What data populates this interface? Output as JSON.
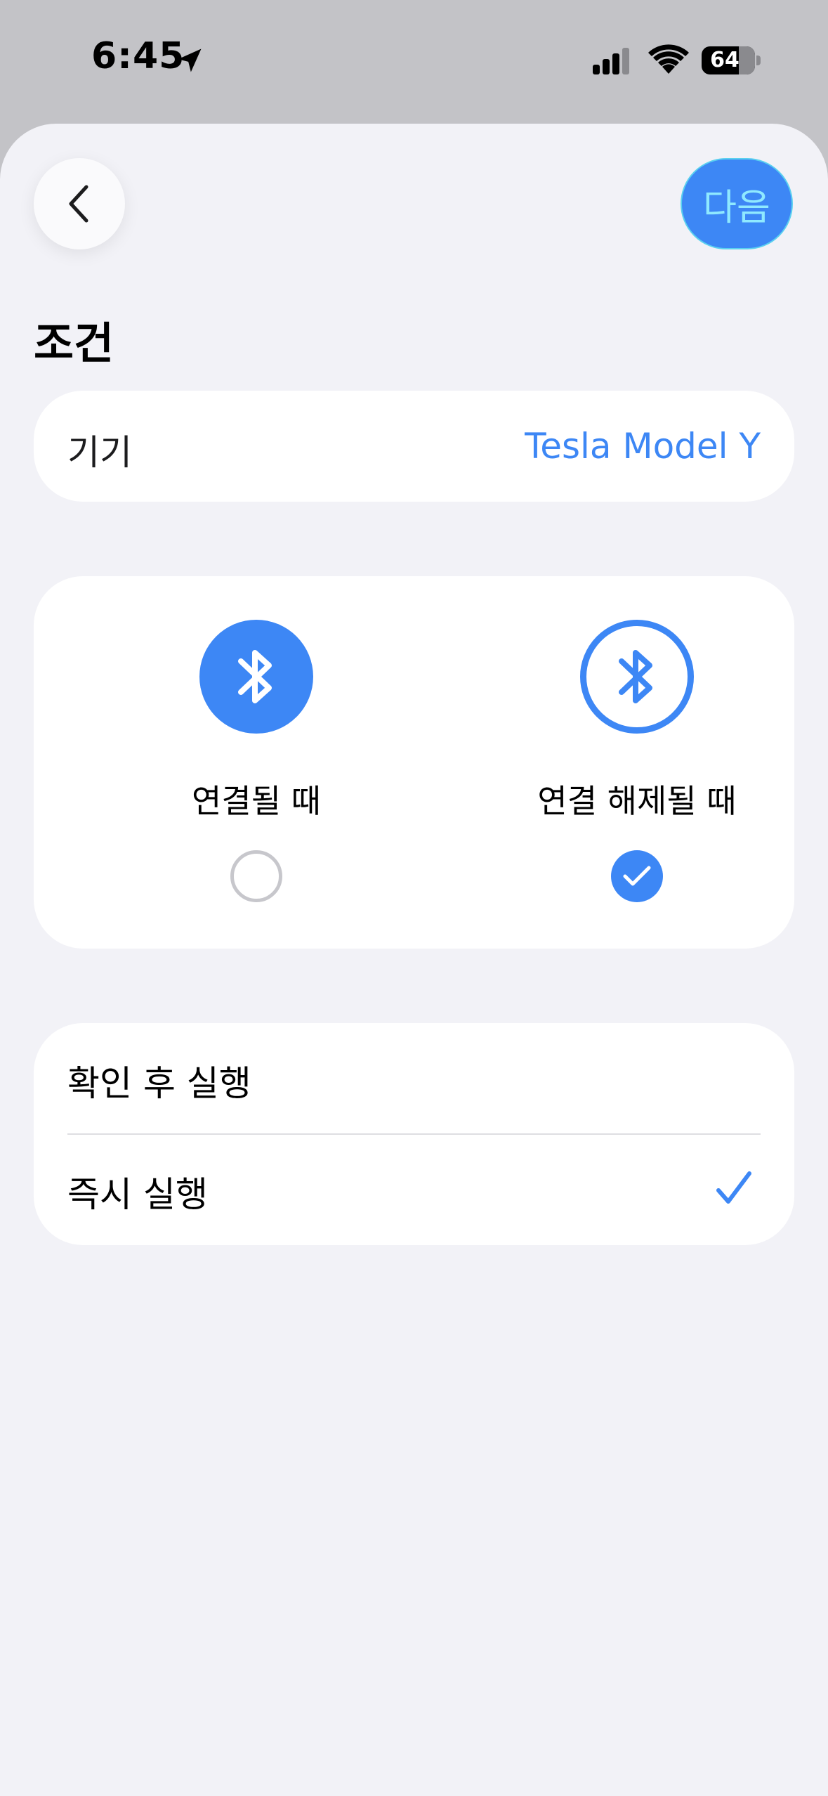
{
  "status_bar": {
    "time": "6:45",
    "battery": "64",
    "battery_level": 0.64
  },
  "nav": {
    "next_label": "다음"
  },
  "section": {
    "title": "조건"
  },
  "device": {
    "label": "기기",
    "value": "Tesla Model Y"
  },
  "trigger": {
    "options": [
      {
        "label": "연결될 때",
        "icon": "bluetooth-filled-icon",
        "selected": false
      },
      {
        "label": "연결 해제될 때",
        "icon": "bluetooth-outline-icon",
        "selected": true
      }
    ]
  },
  "mode": {
    "items": [
      {
        "label": "확인 후 실행",
        "selected": false
      },
      {
        "label": "즉시 실행",
        "selected": true
      }
    ]
  },
  "colors": {
    "accent": "#3d87f5",
    "background": "#f2f2f7",
    "status_bar_bg": "#c3c3c7"
  }
}
